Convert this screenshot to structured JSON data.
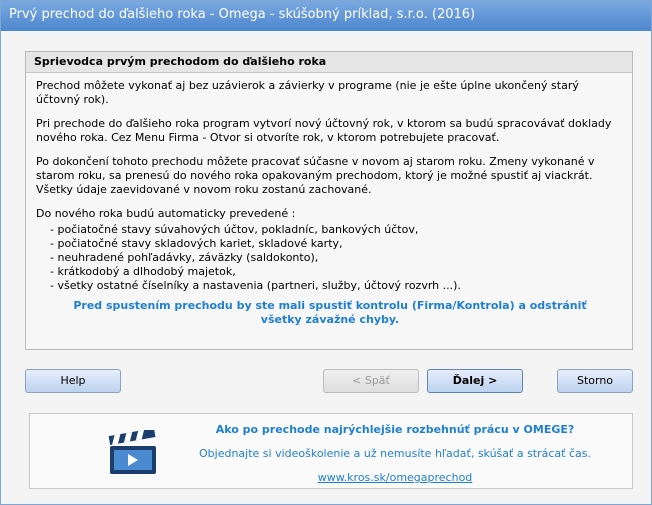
{
  "window": {
    "title": "Prvý prechod do ďalšieho roka - Omega - skúšobný príklad, s.r.o. (2016)"
  },
  "wizard": {
    "heading": "Sprievodca prvým prechodom do ďalšieho roka",
    "paragraphs": [
      "Prechod môžete vykonať aj bez uzávierok a závierky v programe (nie je ešte úplne ukončený starý účtovný rok).",
      "Pri prechode do ďalšieho roka program vytvorí nový účtovný rok, v ktorom sa budú spracovávať doklady nového roka. Cez Menu Firma - Otvor si otvoríte rok, v ktorom potrebujete pracovať.",
      "Po dokončení tohoto prechodu môžete pracovať súčasne v novom aj starom roku. Zmeny vykonané v starom roku, sa prenesú do nového roka opakovaným prechodom, ktorý je možné spustiť aj viackrát. Všetky údaje zaevidované v novom roku zostanú zachované.",
      "Do nového roka budú automaticky prevedené :"
    ],
    "items": [
      "- počiatočné stavy súvahových účtov, pokladníc, bankových účtov,",
      "- počiatočné stavy skladových kariet, skladové karty,",
      "- neuhradené pohľadávky, záväzky (saldokonto),",
      "- krátkodobý a dlhodobý majetok,",
      "- všetky ostatné číselníky a nastavenia (partneri, služby, účtový rozvrh ...)."
    ],
    "warning": "Pred spustením prechodu by ste mali spustiť kontrolu (Firma/Kontrola) a odstrániť všetky závažné chyby."
  },
  "buttons": {
    "help": "Help",
    "back": "< Späť",
    "next": "Ďalej >",
    "cancel": "Storno"
  },
  "promo": {
    "title": "Ako po prechode najrýchlejšie rozbehnúť prácu v OMEGE?",
    "subtitle": "Objednajte si videoškolenie a už nemusíte hľadať, skúšať a strácať čas.",
    "link": "www.kros.sk/omegaprechod",
    "icon": "clapperboard-icon"
  },
  "colors": {
    "accent": "#1f7fd0",
    "titlebar": "#5a90d6"
  }
}
